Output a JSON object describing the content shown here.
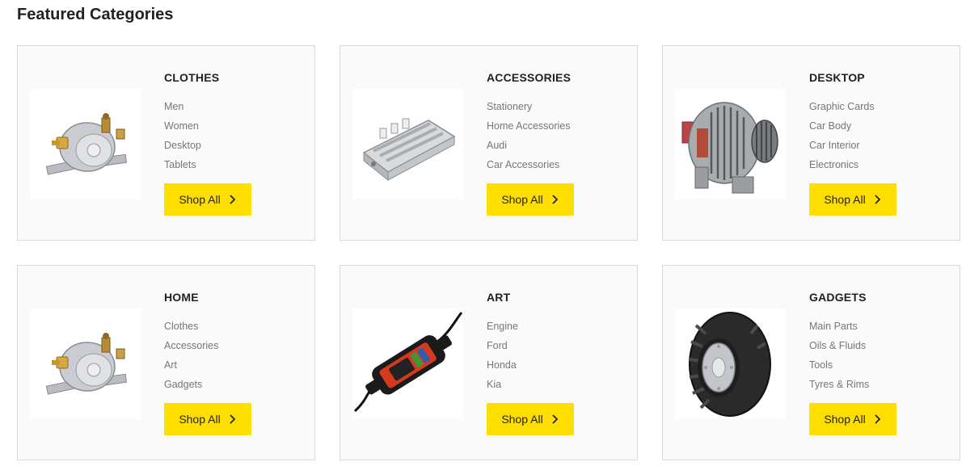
{
  "section": {
    "title": "Featured Categories"
  },
  "accent_color": "#ffdf00",
  "cards": [
    {
      "title": "CLOTHES",
      "image": "solenoid-relay-icon",
      "links": [
        "Men",
        "Women",
        "Desktop",
        "Tablets"
      ],
      "button": "Shop All"
    },
    {
      "title": "ACCESSORIES",
      "image": "voltage-regulator-icon",
      "links": [
        "Stationery",
        "Home Accessories",
        "Audi",
        "Car Accessories"
      ],
      "button": "Shop All"
    },
    {
      "title": "DESKTOP",
      "image": "alternator-icon",
      "links": [
        "Graphic Cards",
        "Car Body",
        "Car Interior",
        "Electronics"
      ],
      "button": "Shop All"
    },
    {
      "title": "HOME",
      "image": "solenoid-relay-icon",
      "links": [
        "Clothes",
        "Accessories",
        "Art",
        "Gadgets"
      ],
      "button": "Shop All"
    },
    {
      "title": "ART",
      "image": "battery-charger-icon",
      "links": [
        "Engine",
        "Ford",
        "Honda",
        "Kia"
      ],
      "button": "Shop All"
    },
    {
      "title": "GADGETS",
      "image": "tire-icon",
      "links": [
        "Main Parts",
        "Oils & Fluids",
        "Tools",
        "Tyres & Rims"
      ],
      "button": "Shop All"
    }
  ]
}
